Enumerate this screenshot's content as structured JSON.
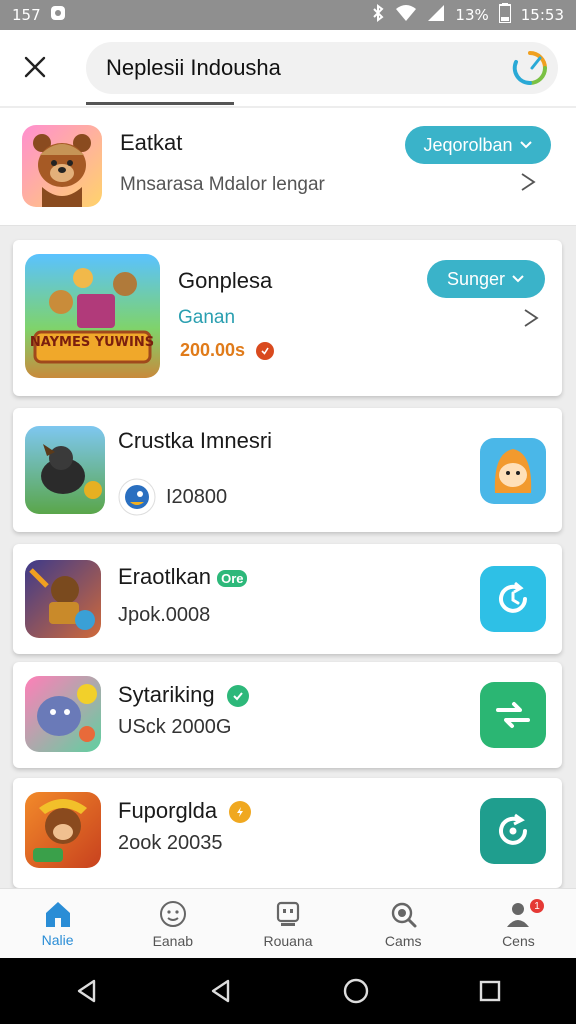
{
  "status_bar": {
    "time_left": "157",
    "battery": "13%",
    "time": "15:53"
  },
  "search": {
    "query": "Neplesii Indousha",
    "placeholder": ""
  },
  "top_result": {
    "title": "Eatkat",
    "subtitle": "Mnsarasa Mdalor lengar",
    "button_label": "Jeqorolban"
  },
  "cards": [
    {
      "title": "Gonplesa",
      "subtitle": "Ganan",
      "price": "200.00s",
      "button_label": "Sunger",
      "icon_text": "NAYMES YUWINS"
    },
    {
      "title": "Crustka Imnesri",
      "meta": "I20800"
    },
    {
      "title": "Eraotlkan",
      "badge": "Ore",
      "meta": "Jpok.0008"
    },
    {
      "title": "Sytariking",
      "meta": "USck 2000G"
    },
    {
      "title": "Fuporglda",
      "meta": "2ook 20035"
    }
  ],
  "bottom_nav": [
    {
      "label": "Nalie",
      "icon": "home-icon",
      "active": true
    },
    {
      "label": "Eanab",
      "icon": "smiley-icon",
      "active": false
    },
    {
      "label": "Rouana",
      "icon": "robot-icon",
      "active": false
    },
    {
      "label": "Cams",
      "icon": "search-icon",
      "active": false
    },
    {
      "label": "Cens",
      "icon": "profile-icon",
      "active": false,
      "badge": "1"
    }
  ],
  "colors": {
    "accent": "#3ab3c9",
    "nav_active": "#2a8dd6",
    "price": "#e07b1a",
    "link_teal": "#2a9fb0"
  }
}
